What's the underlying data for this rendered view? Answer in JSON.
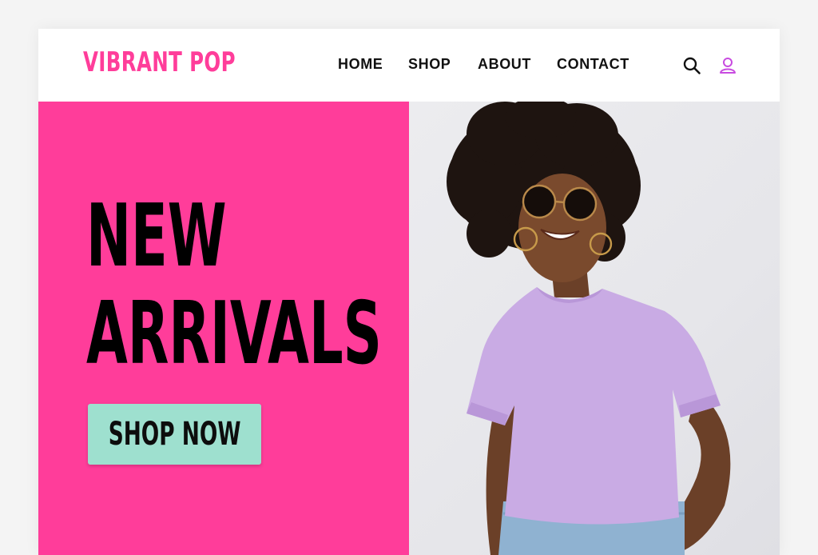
{
  "brand": {
    "logo_text": "VIBRANT POP",
    "colors": {
      "primary_pink": "#ff3d9a",
      "cta_mint": "#9ee0cf",
      "shirt_lavender": "#c9abe4",
      "text_dark": "#111111"
    }
  },
  "nav": {
    "items": [
      {
        "label": "HOME"
      },
      {
        "label": "SHOP"
      },
      {
        "label": "ABOUT"
      },
      {
        "label": "CONTACT"
      }
    ],
    "icons": [
      "search-icon",
      "user-icon"
    ]
  },
  "hero": {
    "title_line1": "NEW",
    "title_line2": "ARRIVALS",
    "cta_label": "SHOP NOW",
    "image": "smiling woman with afro hair, round sunglasses and lavender t-shirt"
  }
}
